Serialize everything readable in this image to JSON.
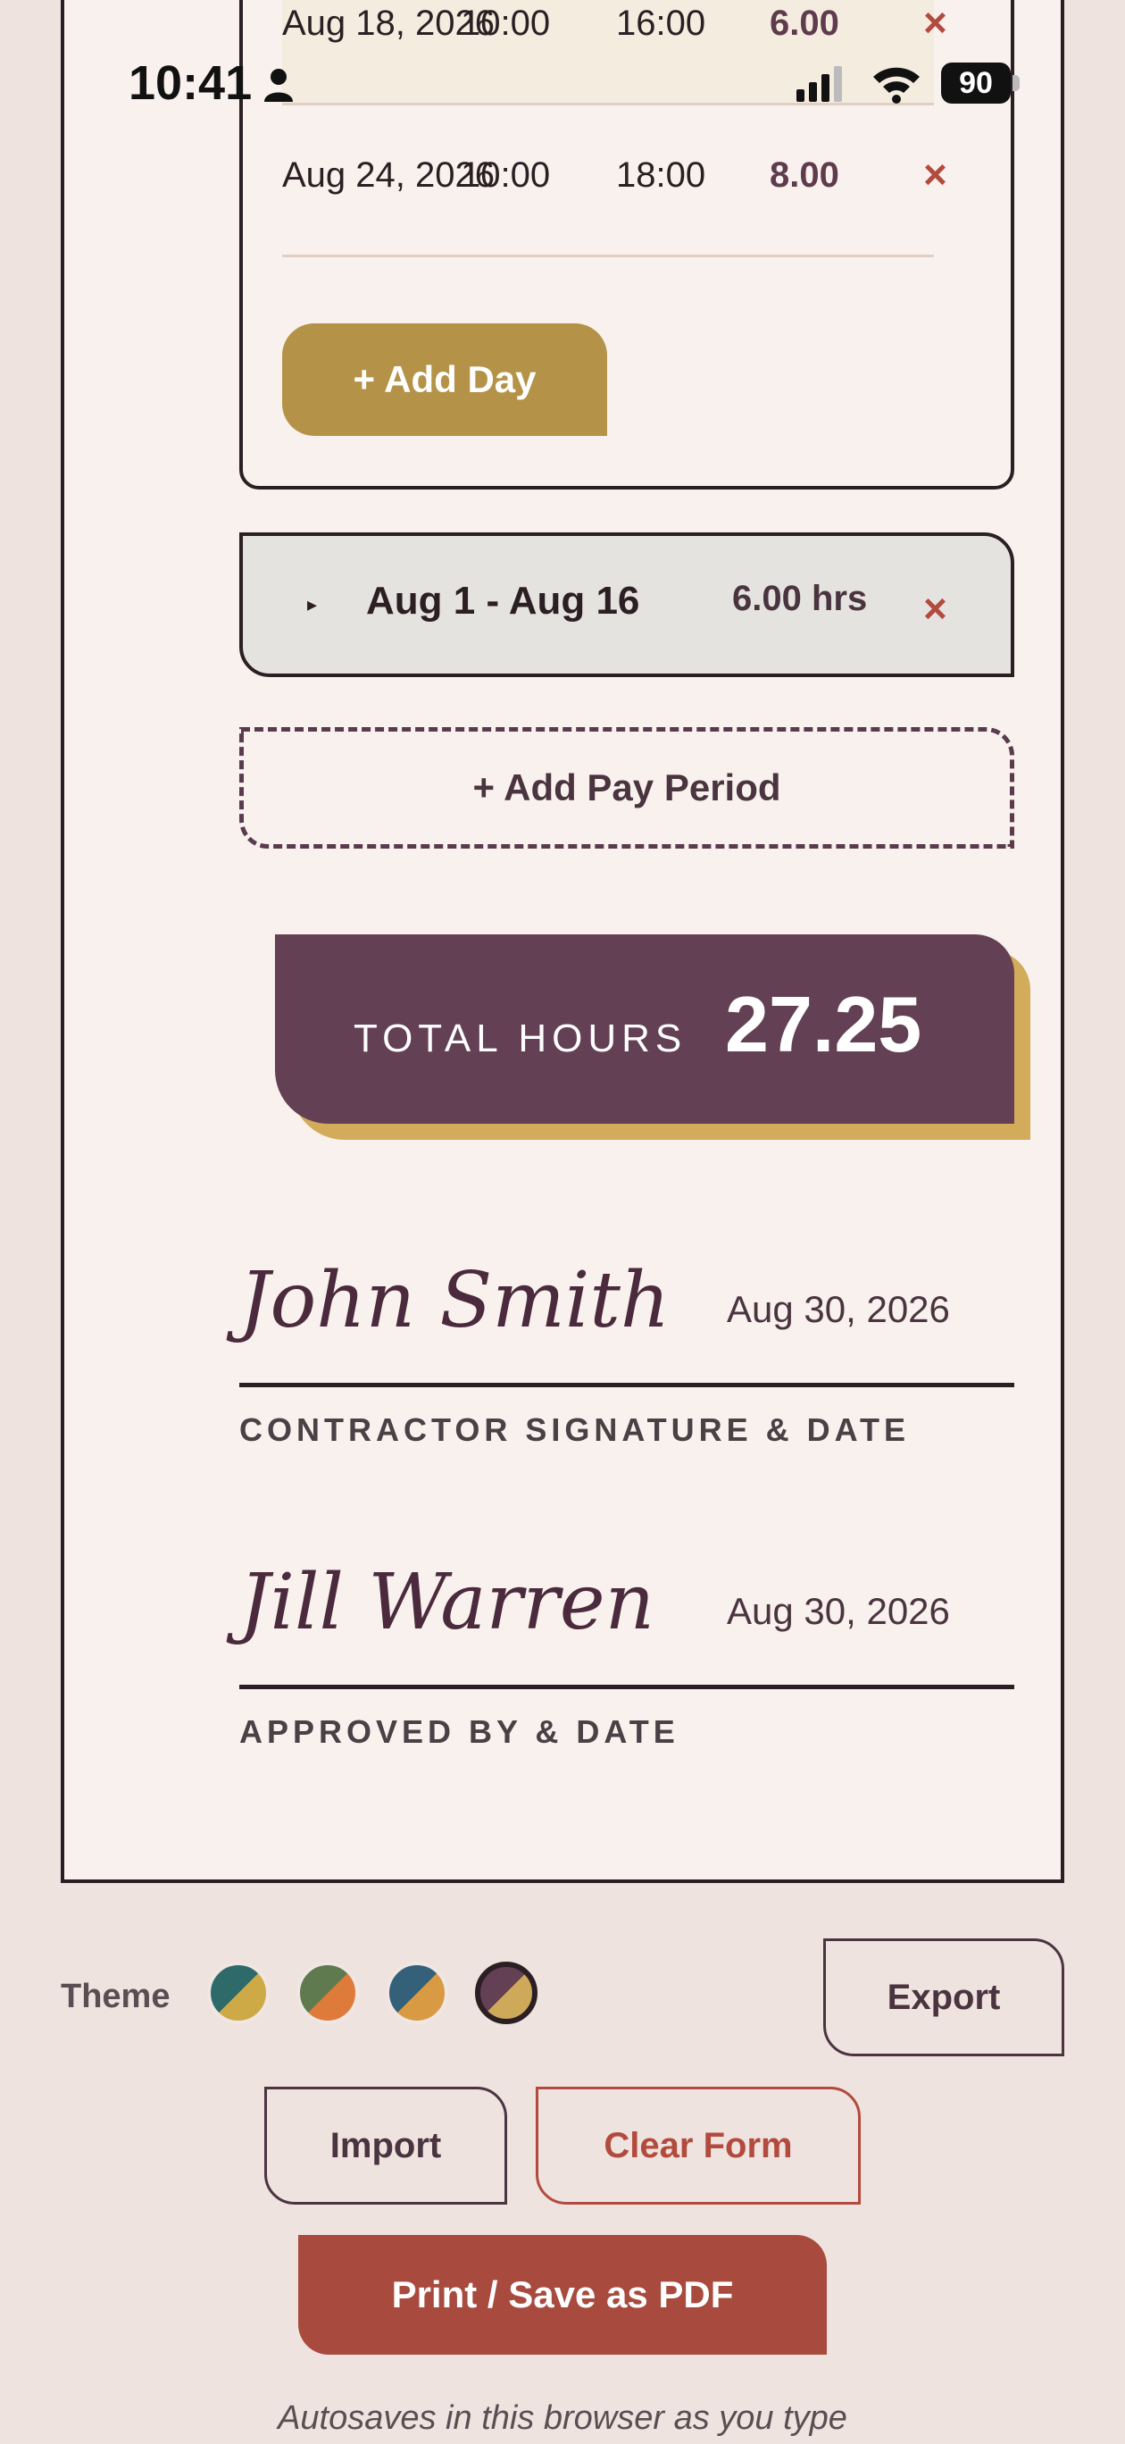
{
  "status_bar": {
    "time": "10:41",
    "battery": "90"
  },
  "pay_period_open": {
    "rows": [
      {
        "date": "Aug 18, 2026",
        "start": "10:00",
        "end": "16:00",
        "hours": "6.00",
        "delete": "×"
      },
      {
        "date": "Aug 24, 2026",
        "start": "10:00",
        "end": "18:00",
        "hours": "8.00",
        "delete": "×"
      }
    ],
    "add_day_label": "+ Add Day"
  },
  "pay_period_collapsed": {
    "toggle": "▸",
    "label": "Aug 1 - Aug 16",
    "hours": "6.00 hrs",
    "delete": "×"
  },
  "add_pay_period_label": "+ Add Pay Period",
  "total": {
    "label": "TOTAL HOURS",
    "value": "27.25"
  },
  "signatures": [
    {
      "name": "John Smith",
      "date": "Aug 30, 2026",
      "caption": "CONTRACTOR SIGNATURE & DATE"
    },
    {
      "name": "Jill Warren",
      "date": "Aug 30, 2026",
      "caption": "APPROVED BY & DATE"
    }
  ],
  "theme": {
    "label": "Theme",
    "swatches": [
      {
        "name": "teal-gold",
        "a": "#2f6a6a",
        "b": "#cdaa45"
      },
      {
        "name": "green-orange",
        "a": "#5e7a4e",
        "b": "#de7b3a"
      },
      {
        "name": "blue-orange",
        "a": "#35607a",
        "b": "#d99a44"
      },
      {
        "name": "plum-gold",
        "a": "#634054",
        "b": "#cfa95a",
        "selected": true
      }
    ]
  },
  "buttons": {
    "export": "Export",
    "import": "Import",
    "clear": "Clear Form",
    "print": "Print / Save as PDF"
  },
  "autosave_note": "Autosaves in this browser as you type"
}
